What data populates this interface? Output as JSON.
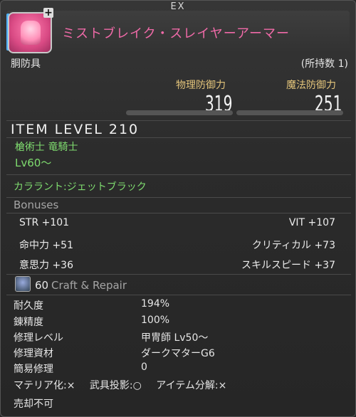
{
  "header": {
    "rarity": "EX"
  },
  "item": {
    "name": "ミストブレイク・スレイヤーアーマー",
    "category": "胴防具",
    "owned": "(所持数 1)",
    "icon": "armor-icon"
  },
  "stats": [
    {
      "label": "物理防御力",
      "value": "319"
    },
    {
      "label": "魔法防御力",
      "value": "251"
    }
  ],
  "item_level": "ITEM LEVEL 210",
  "jobs": "槍術士 竜騎士",
  "level_req": "Lv60～",
  "dye": "カララント:ジェットブラック",
  "bonuses": {
    "title": "Bonuses",
    "items": [
      {
        "left": "STR +101",
        "right": "VIT +107"
      },
      {
        "left": "命中力 +51",
        "right": "クリティカル +73"
      },
      {
        "left": "意思力 +36",
        "right": "スキルスピード +37"
      }
    ]
  },
  "craft": {
    "level": "60",
    "title": "Craft & Repair",
    "rows": [
      {
        "label": "耐久度",
        "value": "194%"
      },
      {
        "label": "錬精度",
        "value": "100%"
      },
      {
        "label": "修理レベル",
        "value": "甲冑師 Lv50～"
      },
      {
        "label": "修理資材",
        "value": "ダークマターG6"
      },
      {
        "label": "簡易修理",
        "value": "0"
      }
    ]
  },
  "flags": [
    "マテリア化:×",
    "武具投影:○",
    "アイテム分解:×"
  ],
  "sell": "売却不可",
  "colors": {
    "name": "#f06aa8",
    "green": "#7fdc6f",
    "stat_label": "#e3c47a"
  }
}
